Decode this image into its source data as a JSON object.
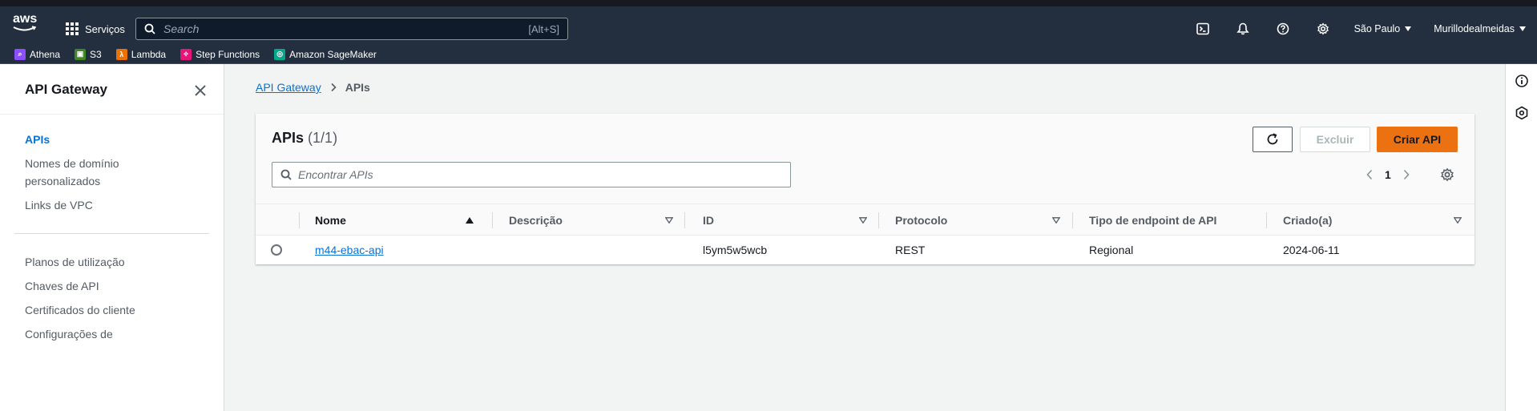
{
  "topnav": {
    "logo_text": "aws",
    "services_label": "Serviços",
    "search_placeholder": "Search",
    "search_shortcut": "[Alt+S]",
    "icons": [
      "cloudshell-icon",
      "notifications-icon",
      "help-icon",
      "settings-icon"
    ],
    "region_label": "São Paulo",
    "account_label": "Murillodealmeidas"
  },
  "favorites": [
    {
      "label": "Athena",
      "color": "#8c4fff"
    },
    {
      "label": "S3",
      "color": "#3f8624"
    },
    {
      "label": "Lambda",
      "color": "#ed7100"
    },
    {
      "label": "Step Functions",
      "color": "#e7157b"
    },
    {
      "label": "Amazon SageMaker",
      "color": "#01a88d"
    }
  ],
  "sidebar": {
    "title": "API Gateway",
    "items": [
      {
        "label": "APIs"
      },
      {
        "label": "Nomes de domínio"
      },
      {
        "label": "personalizados"
      },
      {
        "label": "Links de VPC"
      },
      {
        "label": "Planos de utilização"
      },
      {
        "label": "Chaves de API"
      },
      {
        "label": "Certificados do cliente"
      },
      {
        "label": "Configurações de"
      }
    ]
  },
  "breadcrumb": {
    "root": "API Gateway",
    "current": "APIs"
  },
  "panel": {
    "title": "APIs",
    "count": "(1/1)",
    "delete_label": "Excluir",
    "create_label": "Criar API",
    "filter_placeholder": "Encontrar APIs",
    "page_number": "1"
  },
  "table": {
    "columns": [
      {
        "label": "Nome"
      },
      {
        "label": "Descrição"
      },
      {
        "label": "ID"
      },
      {
        "label": "Protocolo"
      },
      {
        "label": "Tipo de endpoint de API"
      },
      {
        "label": "Criado(a)"
      }
    ],
    "rows": [
      {
        "name": "m44-ebac-api",
        "description": "",
        "id": "l5ym5w5wcb",
        "protocol": "REST",
        "endpoint_type": "Regional",
        "created": "2024-06-11"
      }
    ]
  },
  "colors": {
    "accent": "#ec7211",
    "link": "#0972d3",
    "nav_bg": "#232f3e"
  }
}
